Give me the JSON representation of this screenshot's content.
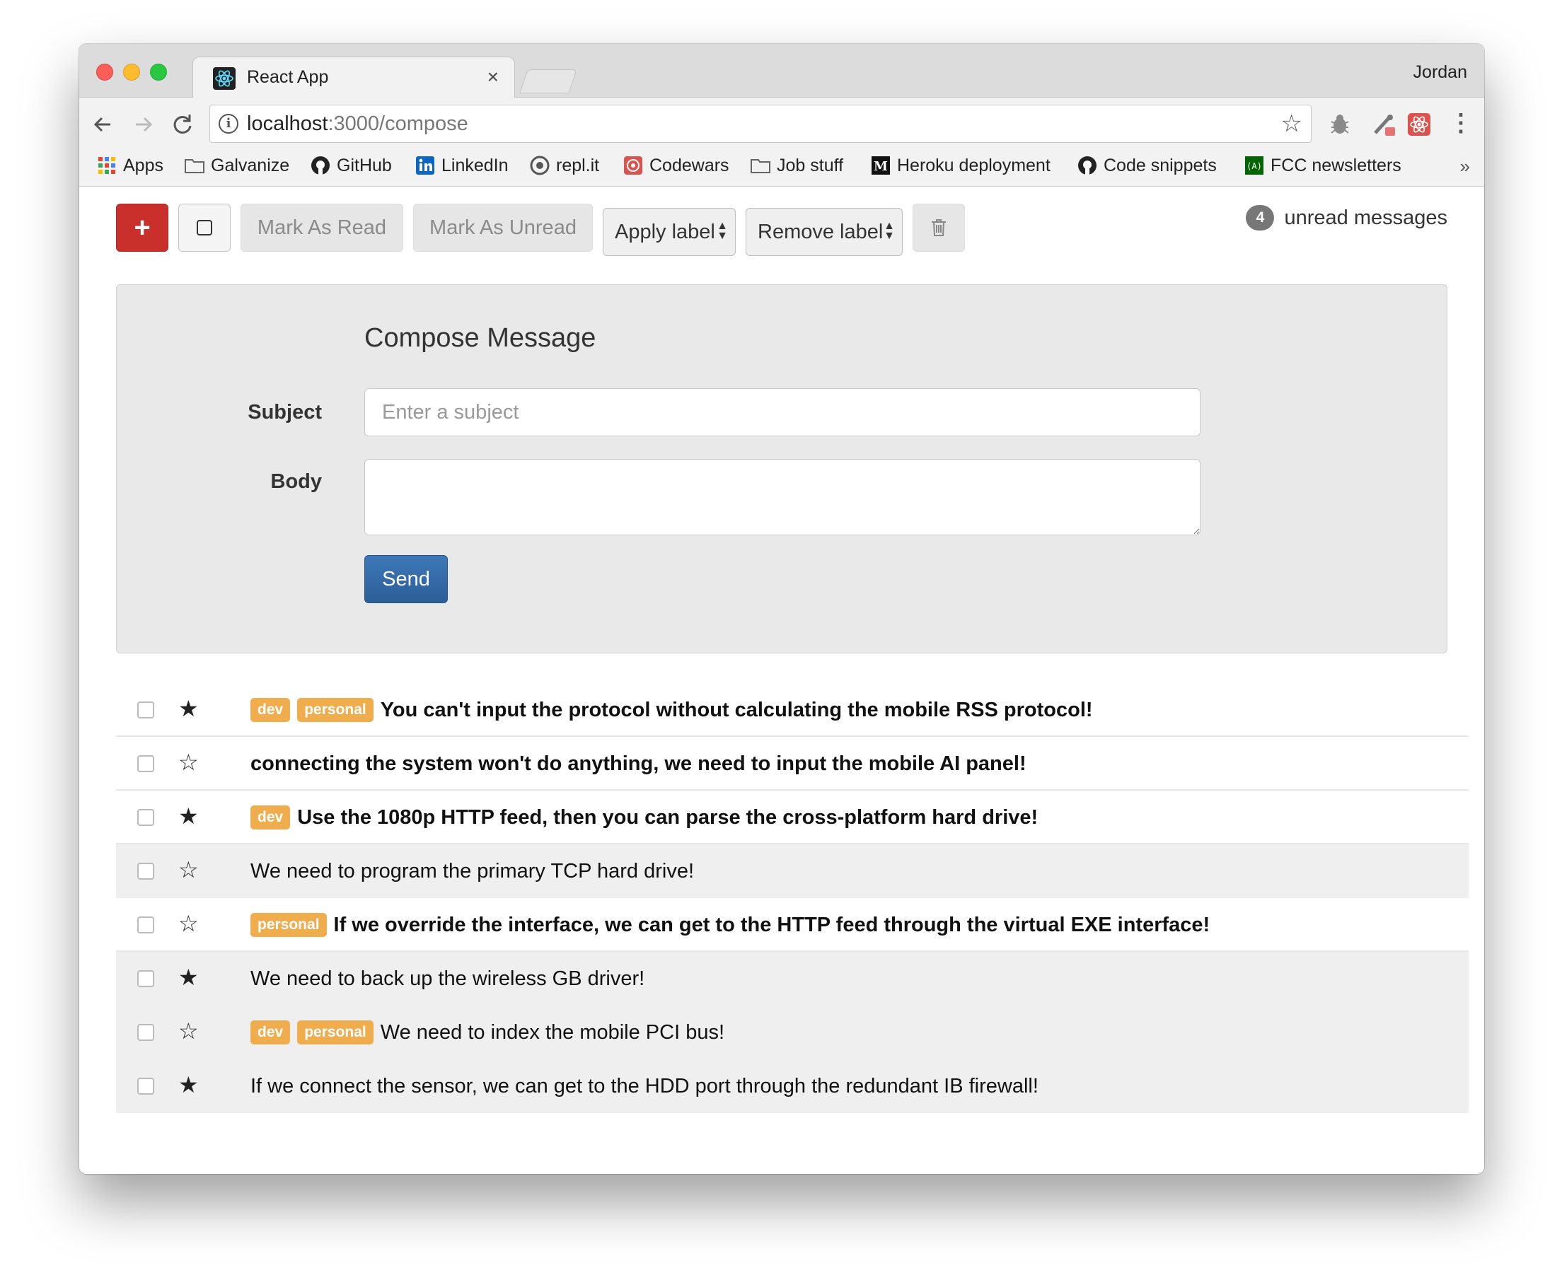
{
  "browser": {
    "tab_title": "React App",
    "tab_close": "×",
    "profile_name": "Jordan",
    "url_host": "localhost",
    "url_path": ":3000/compose",
    "bookmarks": [
      {
        "label": "Apps",
        "icon": "apps-grid-icon"
      },
      {
        "label": "Galvanize",
        "icon": "folder-icon"
      },
      {
        "label": "GitHub",
        "icon": "github-icon"
      },
      {
        "label": "LinkedIn",
        "icon": "linkedin-icon"
      },
      {
        "label": "repl.it",
        "icon": "replit-icon"
      },
      {
        "label": "Codewars",
        "icon": "codewars-icon"
      },
      {
        "label": "Job stuff",
        "icon": "folder-icon"
      },
      {
        "label": "Heroku deployment",
        "icon": "medium-icon"
      },
      {
        "label": "Code snippets",
        "icon": "github-icon"
      },
      {
        "label": "FCC newsletters",
        "icon": "fcc-icon"
      }
    ],
    "bookmarks_more": "»"
  },
  "toolbar": {
    "compose_label": "+",
    "mark_read_label": "Mark As Read",
    "mark_unread_label": "Mark As Unread",
    "apply_label": "Apply label",
    "remove_label": "Remove label",
    "unread_count": "4",
    "unread_text": "unread messages"
  },
  "compose": {
    "title": "Compose Message",
    "subject_label": "Subject",
    "subject_placeholder": "Enter a subject",
    "subject_value": "",
    "body_label": "Body",
    "body_value": "",
    "send_label": "Send"
  },
  "messages": [
    {
      "read": false,
      "starred": true,
      "labels": [
        "dev",
        "personal"
      ],
      "subject": "You can't input the protocol without calculating the mobile RSS protocol!"
    },
    {
      "read": false,
      "starred": false,
      "labels": [],
      "subject": "connecting the system won't do anything, we need to input the mobile AI panel!"
    },
    {
      "read": false,
      "starred": true,
      "labels": [
        "dev"
      ],
      "subject": "Use the 1080p HTTP feed, then you can parse the cross-platform hard drive!"
    },
    {
      "read": true,
      "starred": false,
      "labels": [],
      "subject": "We need to program the primary TCP hard drive!"
    },
    {
      "read": false,
      "starred": false,
      "labels": [
        "personal"
      ],
      "subject": "If we override the interface, we can get to the HTTP feed through the virtual EXE interface!"
    },
    {
      "read": true,
      "starred": true,
      "labels": [],
      "subject": "We need to back up the wireless GB driver!"
    },
    {
      "read": true,
      "starred": false,
      "labels": [
        "dev",
        "personal"
      ],
      "subject": "We need to index the mobile PCI bus!"
    },
    {
      "read": true,
      "starred": true,
      "labels": [],
      "subject": "If we connect the sensor, we can get to the HDD port through the redundant IB firewall!"
    }
  ],
  "colors": {
    "compose_button": "#c9302c",
    "send_button": "#2c5e96",
    "label_tag": "#f0ad4e",
    "read_row": "#efefef"
  }
}
